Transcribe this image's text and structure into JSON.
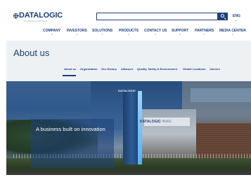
{
  "brand": {
    "name": "DATALOGIC",
    "tagline": "Your Partner for Business"
  },
  "header": {
    "search_placeholder": "",
    "language": "ENG"
  },
  "nav": {
    "items": [
      {
        "label": "COMPANY"
      },
      {
        "label": "INVESTORS"
      },
      {
        "label": "SOLUTIONS"
      },
      {
        "label": "PRODUCTS"
      },
      {
        "label": "CONTACT US"
      },
      {
        "label": "SUPPORT"
      },
      {
        "label": "PARTNERS"
      },
      {
        "label": "MEDIA CENTER"
      }
    ]
  },
  "page": {
    "title": "About us"
  },
  "subnav": {
    "items": [
      {
        "label": "About us",
        "active": true
      },
      {
        "label": "Organization"
      },
      {
        "label": "Our History"
      },
      {
        "label": "Alliances"
      },
      {
        "label": "Quality, Safety & Environment"
      },
      {
        "label": "Global Locations"
      },
      {
        "label": "Careers"
      }
    ]
  },
  "hero": {
    "headline": "A business built on innovation",
    "tower_sign": "DATALOGIC",
    "building_sign_brand": "DATALOGIC",
    "building_sign_suffix": "4NAS"
  },
  "colors": {
    "brand_blue": "#1c3f7a",
    "band_gray": "#eef1f4",
    "overlay": "#1c3f7a"
  }
}
